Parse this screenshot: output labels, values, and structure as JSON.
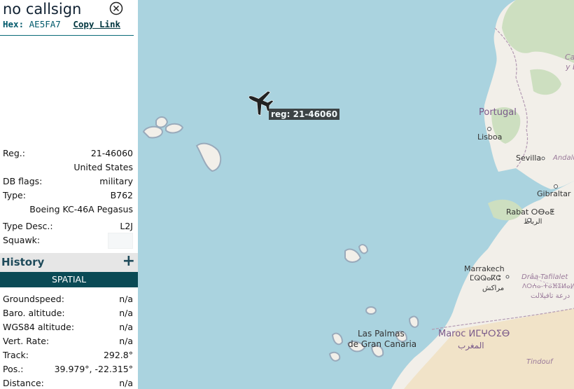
{
  "header": {
    "callsign": "no callsign",
    "hex_label": "Hex:",
    "hex_value": "AE5FA7",
    "copy_link": "Copy Link"
  },
  "details": [
    {
      "key": "Reg.:",
      "value": "21-46060"
    },
    {
      "key": "",
      "value": "United States"
    },
    {
      "key": "DB flags:",
      "value": "military"
    },
    {
      "key": "Type:",
      "value": "B762"
    },
    {
      "key": "",
      "value": "Boeing KC-46A Pegasus"
    },
    {
      "key": "Type Desc.:",
      "value": "L2J"
    },
    {
      "key": "Squawk:",
      "value": ""
    }
  ],
  "history": {
    "title": "History",
    "plus": "+"
  },
  "spatial": {
    "label": "SPATIAL"
  },
  "spatial_rows": [
    {
      "key": "Groundspeed:",
      "value": "n/a"
    },
    {
      "key": "Baro. altitude:",
      "value": "n/a"
    },
    {
      "key": "WGS84 altitude:",
      "value": "n/a"
    },
    {
      "key": "Vert. Rate:",
      "value": "n/a"
    },
    {
      "key": "Track:",
      "value": "292.8°"
    },
    {
      "key": "Pos.:",
      "value": "39.979°, -22.315°"
    },
    {
      "key": "Distance:",
      "value": "n/a"
    }
  ],
  "map": {
    "aircraft_label": "reg: 21-46060",
    "labels": {
      "portugal": "Portugal",
      "lisboa": "Lisboa",
      "sevilla": "Sevilla",
      "andalu": "Andalu",
      "gibraltar": "Gibraltar",
      "rabat": "Rabat ⵔⴱⴰⵟ",
      "rabat_ar": "الرباط",
      "marrakech": "Marrakech",
      "marrakech_tz": "ⵎⵕⵕⴰⴽⵛ",
      "marrakech_ar": "مراكش",
      "draa": "Drâa-Tafilalet",
      "draa_tz": "ⴷⵔⵄⴰ-ⵜⴰⴼⵉⵍⴰⵍⵜ",
      "draa_ar": "درعة تافيلالت",
      "laspalmas1": "Las Palmas",
      "laspalmas2": "de Gran Canaria",
      "maroc": "Maroc ⵍⵎⵖⵔⵉⴱ",
      "maroc_ar": "المغرب",
      "tindouf": "Tindouf",
      "ca": "Ca",
      "y": "y L"
    },
    "colors": {
      "water": "#aad3df",
      "land": "#f2efe9",
      "green": "#cddfc0",
      "desert": "#f1e3c8",
      "border": "#b39ab3"
    }
  }
}
